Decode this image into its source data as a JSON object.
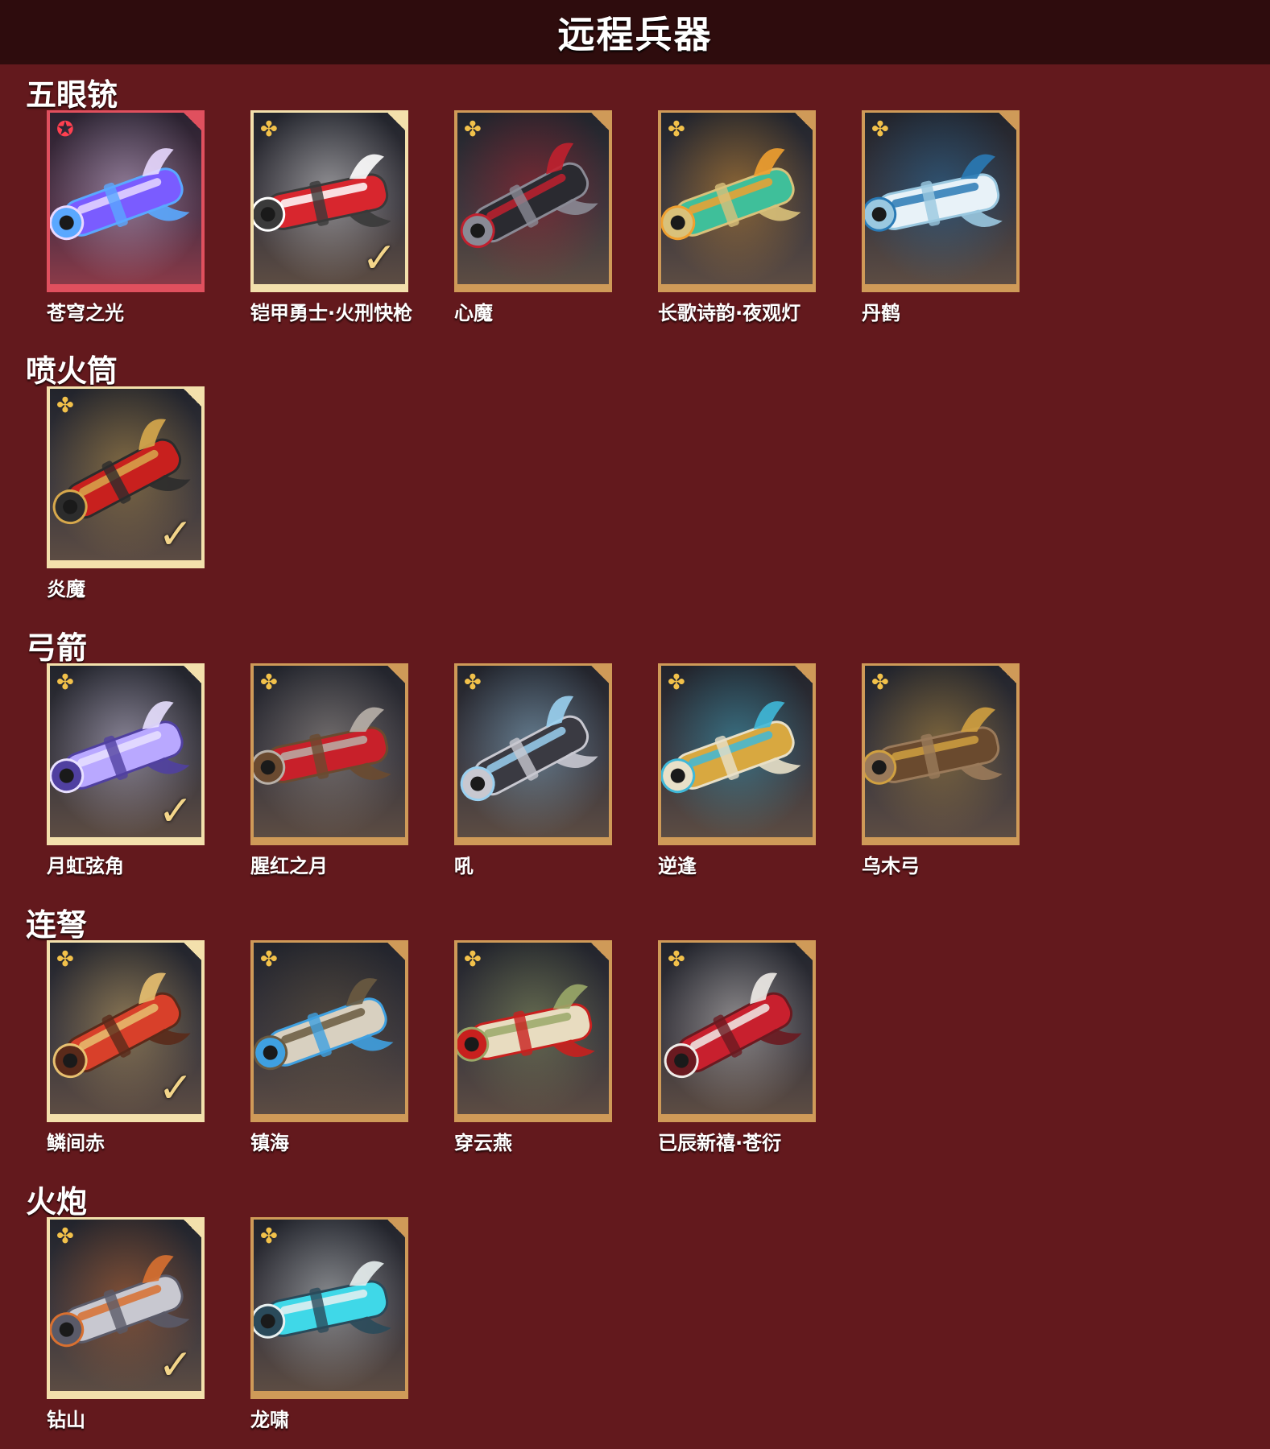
{
  "page": {
    "title": "远程兵器"
  },
  "sections": [
    {
      "title": "五眼铳",
      "items": [
        {
          "name": "苍穹之光",
          "rarity": "red",
          "equipped": false,
          "art": "purple-wisp-launcher",
          "palette": [
            "#7a5cff",
            "#e8d8ff",
            "#5aa8ff"
          ]
        },
        {
          "name": "铠甲勇士·火刑快枪",
          "rarity": "gold",
          "equipped": true,
          "art": "red-armor-gun",
          "palette": [
            "#d8262e",
            "#ffffff",
            "#3a3a3a"
          ]
        },
        {
          "name": "心魔",
          "rarity": "gold",
          "equipped": false,
          "art": "dark-demon-gun",
          "palette": [
            "#2a2a30",
            "#c0202e",
            "#8a8a95"
          ]
        },
        {
          "name": "长歌诗韵·夜观灯",
          "rarity": "gold",
          "equipped": false,
          "art": "jade-koi-gun",
          "palette": [
            "#3fbf9a",
            "#f0a030",
            "#d9c17a"
          ]
        },
        {
          "name": "丹鹤",
          "rarity": "gold",
          "equipped": false,
          "art": "white-crane-gun",
          "palette": [
            "#e8f2f8",
            "#2a7ab5",
            "#9ac8e0"
          ]
        }
      ]
    },
    {
      "title": "喷火筒",
      "items": [
        {
          "name": "炎魔",
          "rarity": "gold",
          "equipped": true,
          "art": "red-flame-tube",
          "palette": [
            "#c8201e",
            "#d7a84c",
            "#2c2c2c"
          ]
        }
      ]
    },
    {
      "title": "弓箭",
      "items": [
        {
          "name": "月虹弦角",
          "rarity": "gold",
          "equipped": true,
          "art": "moon-bow",
          "palette": [
            "#b9a8ff",
            "#e8e0ff",
            "#5040a0"
          ]
        },
        {
          "name": "腥红之月",
          "rarity": "gold",
          "equipped": false,
          "art": "crimson-bow",
          "palette": [
            "#c8202a",
            "#b8b0a8",
            "#6a4a30"
          ]
        },
        {
          "name": "吼",
          "rarity": "gold",
          "equipped": false,
          "art": "roar-bow",
          "palette": [
            "#3a3a42",
            "#9ad0f0",
            "#c8c8d0"
          ]
        },
        {
          "name": "逆逢",
          "rarity": "gold",
          "equipped": false,
          "art": "gold-blue-bow",
          "palette": [
            "#d8a840",
            "#3fb8d8",
            "#e8e0c8"
          ]
        },
        {
          "name": "乌木弓",
          "rarity": "gold",
          "equipped": false,
          "art": "wooden-bow",
          "palette": [
            "#6a4a2e",
            "#d0a040",
            "#9a7a5a"
          ]
        }
      ]
    },
    {
      "title": "连弩",
      "items": [
        {
          "name": "鳞间赤",
          "rarity": "gold",
          "equipped": true,
          "art": "red-fish-crossbow",
          "palette": [
            "#d8402a",
            "#e8c070",
            "#5a2a1a"
          ]
        },
        {
          "name": "镇海",
          "rarity": "gold",
          "equipped": false,
          "art": "sea-crossbow",
          "palette": [
            "#d8d0c0",
            "#6a5a40",
            "#3fa0e0"
          ]
        },
        {
          "name": "穿云燕",
          "rarity": "gold",
          "equipped": false,
          "art": "swallow-crossbow",
          "palette": [
            "#e8dcc0",
            "#9aa868",
            "#c8201e"
          ]
        },
        {
          "name": "已辰新禧·苍衍",
          "rarity": "gold",
          "equipped": false,
          "art": "red-white-crossbow",
          "palette": [
            "#c8202e",
            "#f0ece8",
            "#6a1a20"
          ]
        }
      ]
    },
    {
      "title": "火炮",
      "items": [
        {
          "name": "钻山",
          "rarity": "gold",
          "equipped": true,
          "art": "silver-cannon",
          "palette": [
            "#c8c8d0",
            "#d87030",
            "#5a5a68"
          ]
        },
        {
          "name": "龙啸",
          "rarity": "gold",
          "equipped": false,
          "art": "dragon-cannon",
          "palette": [
            "#3fd8e8",
            "#e8f0f0",
            "#2a4a5a"
          ]
        }
      ]
    }
  ]
}
